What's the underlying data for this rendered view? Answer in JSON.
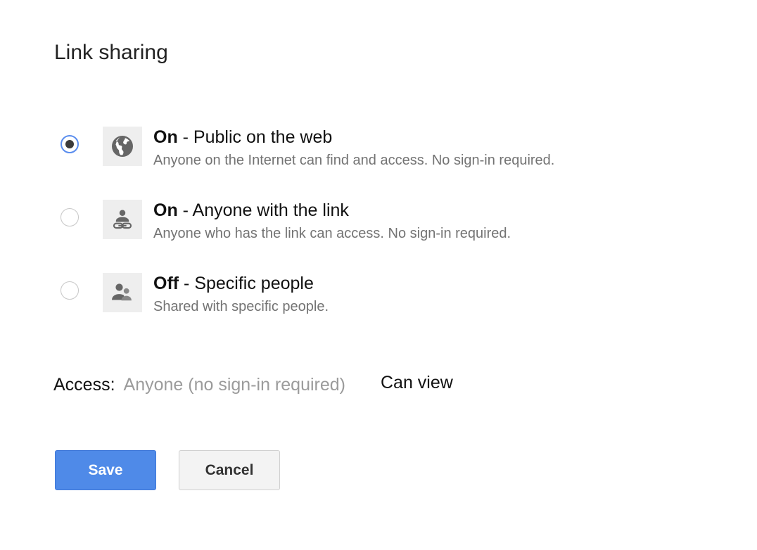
{
  "dialog": {
    "title": "Link sharing"
  },
  "options": [
    {
      "state": "On",
      "label": " - Public on the web",
      "description": "Anyone on the Internet can find and access. No sign-in required.",
      "icon": "globe-icon",
      "selected": true
    },
    {
      "state": "On",
      "label": " - Anyone with the link",
      "description": "Anyone who has the link can access. No sign-in required.",
      "icon": "person-link-icon",
      "selected": false
    },
    {
      "state": "Off",
      "label": " - Specific people",
      "description": "Shared with specific people.",
      "icon": "people-icon",
      "selected": false
    }
  ],
  "access": {
    "label": "Access:",
    "value": "Anyone (no sign-in required)",
    "permission": "Can view"
  },
  "buttons": {
    "save": "Save",
    "cancel": "Cancel"
  },
  "colors": {
    "primary": "#4f8ae8",
    "radio_checked": "#5a8dee",
    "muted_text": "#737373",
    "icon": "#666666"
  }
}
